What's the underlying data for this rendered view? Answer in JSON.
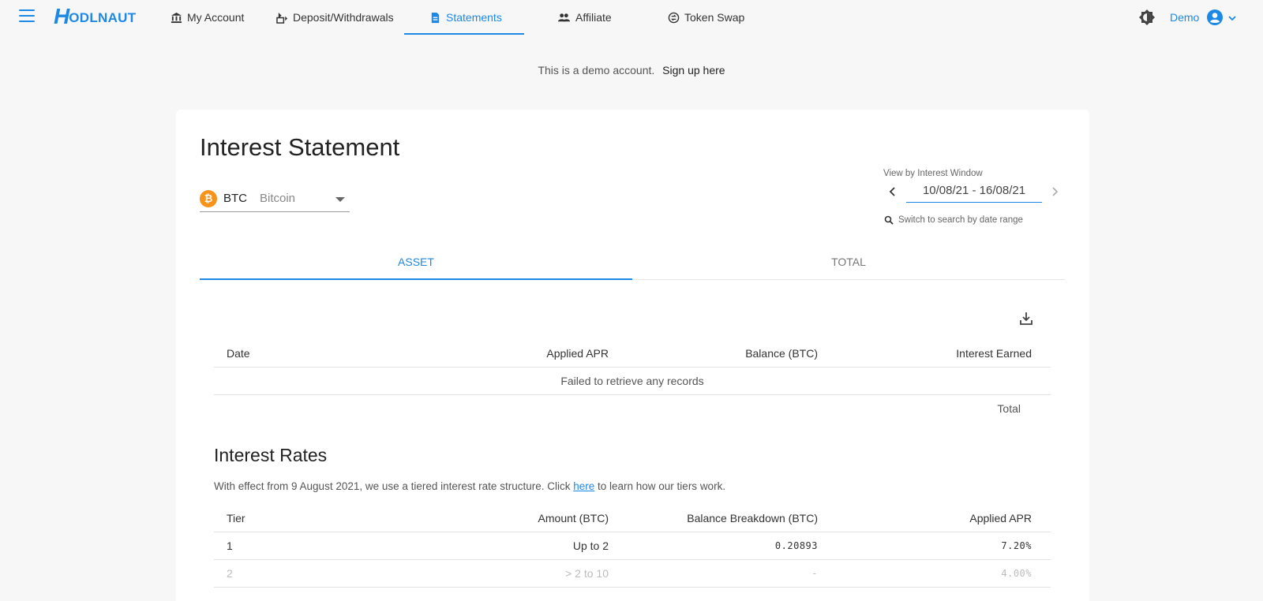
{
  "nav": {
    "logo_text": "HODLNAUT",
    "logo_h": "H",
    "logo_rest": "ODLNAUT",
    "items": [
      {
        "label": "My Account",
        "icon": "bank-icon"
      },
      {
        "label": "Deposit/Withdrawals",
        "icon": "deposit-icon"
      },
      {
        "label": "Statements",
        "icon": "document-icon",
        "active": true
      },
      {
        "label": "Affiliate",
        "icon": "people-icon"
      },
      {
        "label": "Token Swap",
        "icon": "swap-icon"
      }
    ],
    "user": "Demo"
  },
  "demo_banner": {
    "text": "This is a demo account.",
    "link": "Sign up here"
  },
  "statement": {
    "title": "Interest Statement",
    "asset": {
      "code": "BTC",
      "name": "Bitcoin",
      "icon_glyph": "₿"
    },
    "window_label": "View by Interest Window",
    "window_range": "10/08/21 - 16/08/21",
    "date_search": "Switch to search by date range",
    "tabs": [
      "ASSET",
      "TOTAL"
    ],
    "table": {
      "headers": [
        "Date",
        "Applied APR",
        "Balance (BTC)",
        "Interest Earned"
      ],
      "empty_message": "Failed to retrieve any records",
      "total_label": "Total"
    }
  },
  "rates": {
    "title": "Interest Rates",
    "desc_before": "With effect from 9 August 2021, we use a tiered interest rate structure. Click ",
    "desc_link": "here",
    "desc_after": " to learn how our tiers work.",
    "headers": [
      "Tier",
      "Amount (BTC)",
      "Balance Breakdown (BTC)",
      "Applied APR"
    ],
    "rows": [
      {
        "tier": "1",
        "amount": "Up to 2",
        "breakdown": "0.20893",
        "apr": "7.20%"
      },
      {
        "tier": "2",
        "amount": "> 2 to 10",
        "breakdown": "-",
        "apr": "4.00%"
      }
    ]
  },
  "colors": {
    "accent": "#1e88e5",
    "btc": "#f7931a",
    "background": "#f7f7f7"
  }
}
